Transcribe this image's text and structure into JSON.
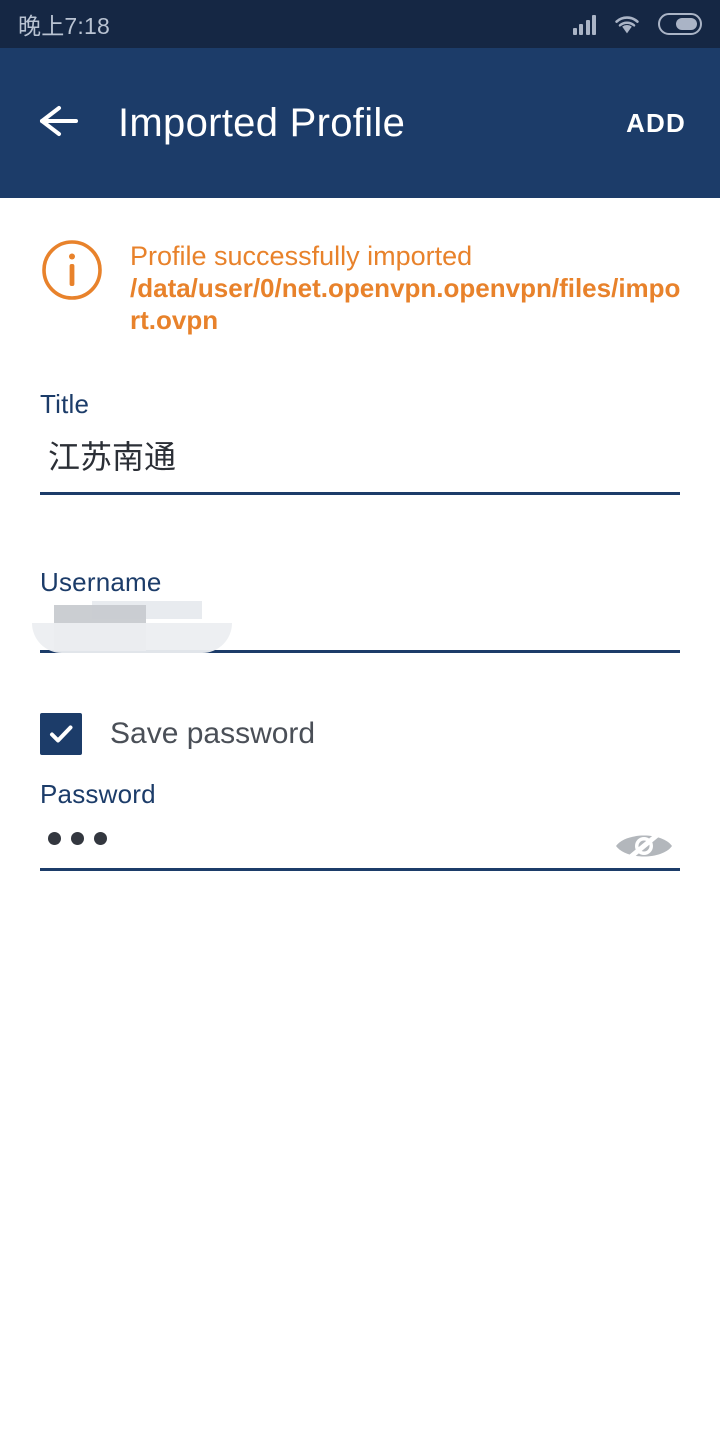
{
  "statusbar": {
    "time": "晚上7:18",
    "icons": {
      "signal": "signal-bars-icon",
      "wifi": "wifi-icon",
      "battery": "battery-icon"
    },
    "battery_level_percent": 62,
    "colors": {
      "background": "#152744",
      "foreground": "#aab4c6"
    }
  },
  "appbar": {
    "back_icon": "back-arrow-icon",
    "title": "Imported Profile",
    "action_label": "ADD",
    "colors": {
      "background": "#1c3c69",
      "foreground": "#ffffff"
    }
  },
  "banner": {
    "icon": "info-circle-icon",
    "message": "Profile successfully imported",
    "path": "/data/user/0/net.openvpn.openvpn/files/import.ovpn",
    "color": "#e8822b"
  },
  "form": {
    "title_field": {
      "label": "Title",
      "value": "江苏南通",
      "placeholder": ""
    },
    "username_field": {
      "label": "Username",
      "value": "",
      "placeholder": "",
      "redacted": true
    },
    "save_password": {
      "label": "Save password",
      "checked": true
    },
    "password_field": {
      "label": "Password",
      "value": "•••",
      "masked_char_count": 3,
      "placeholder": "",
      "toggle_icon": "eye-off-icon"
    },
    "colors": {
      "label": "#1c3c69",
      "underline": "#1c3c69",
      "value": "#2b2f36"
    }
  }
}
